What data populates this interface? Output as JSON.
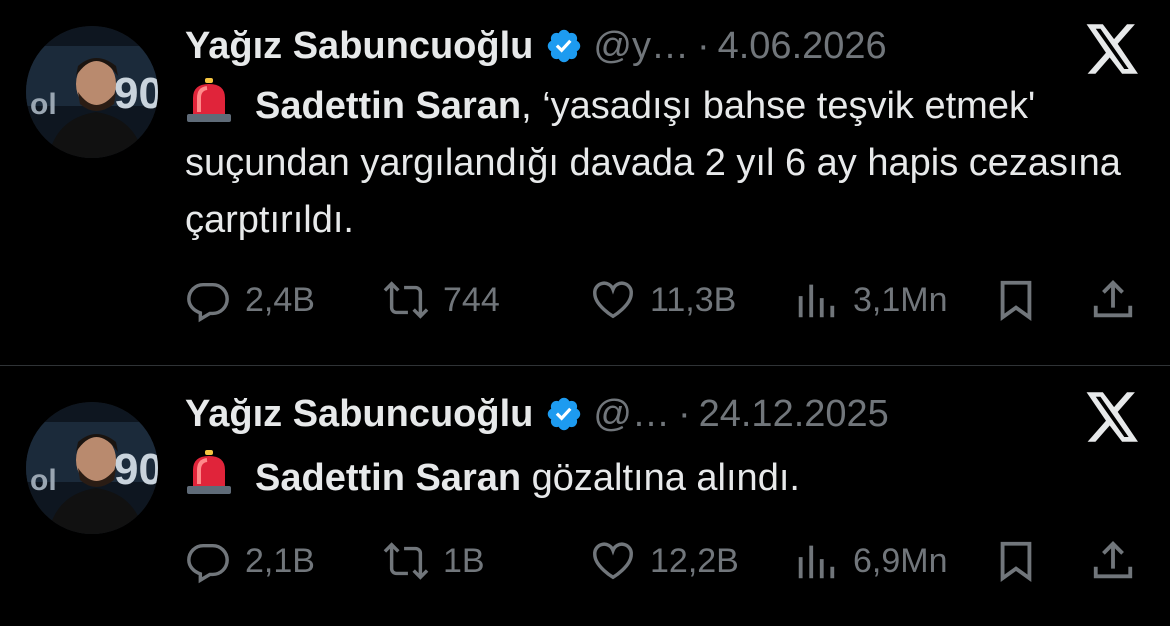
{
  "colors": {
    "background": "#000000",
    "text": "#e7e9ea",
    "muted": "#71767b",
    "verified": "#1d9bf0",
    "divider": "#2f3336"
  },
  "tweets": [
    {
      "author_name": "Yağız Sabuncuoğlu",
      "handle": "@y…",
      "separator": "·",
      "date": "4.06.2026",
      "emoji": "siren-icon",
      "bold_text": "Sadettin Saran",
      "text": ", ‘yasadışı bahse teşvik etmek' suçundan yargılandığı davada 2 yıl 6 ay hapis cezasına çarptırıldı.",
      "replies": "2,4B",
      "retweets": "744",
      "likes": "11,3B",
      "views": "3,1Mn"
    },
    {
      "author_name": "Yağız Sabuncuoğlu",
      "handle": "@…",
      "separator": "·",
      "date": "24.12.2025",
      "emoji": "siren-icon",
      "bold_text": "Sadettin Saran",
      "text": " gözaltına alındı.",
      "replies": "2,1B",
      "retweets": "1B",
      "likes": "12,2B",
      "views": "6,9Mn"
    }
  ]
}
